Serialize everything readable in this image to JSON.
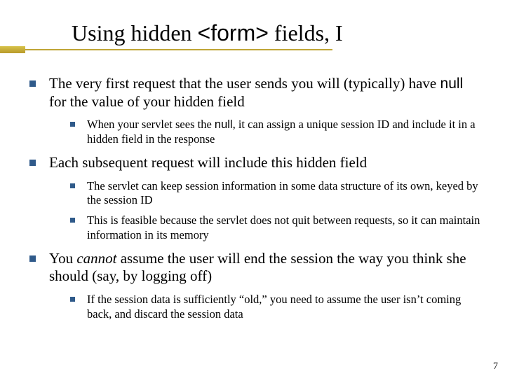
{
  "title": {
    "pre": "Using hidden ",
    "code": "<form>",
    "post": " fields, I"
  },
  "b1": {
    "main_pre": "The very first request that the user sends you will (typically) have ",
    "main_code": "null",
    "main_post": " for the value of your hidden field",
    "sub1_pre": "When your servlet sees the ",
    "sub1_code": "null",
    "sub1_post": ", it can assign a unique session ID and include it in a hidden field in the response"
  },
  "b2": {
    "main": "Each subsequent request will include this hidden field",
    "sub1": "The servlet can keep session information in some data structure of its own, keyed by the session ID",
    "sub2": "This is feasible because the servlet does not quit between requests, so it can maintain information in its memory"
  },
  "b3": {
    "main_pre": "You ",
    "main_ital": "cannot",
    "main_post": " assume the user will end the session the way you think she should (say, by logging off)",
    "sub1": "If the session data is sufficiently “old,” you need to assume the user isn’t coming back, and discard the session data"
  },
  "page_number": "7"
}
